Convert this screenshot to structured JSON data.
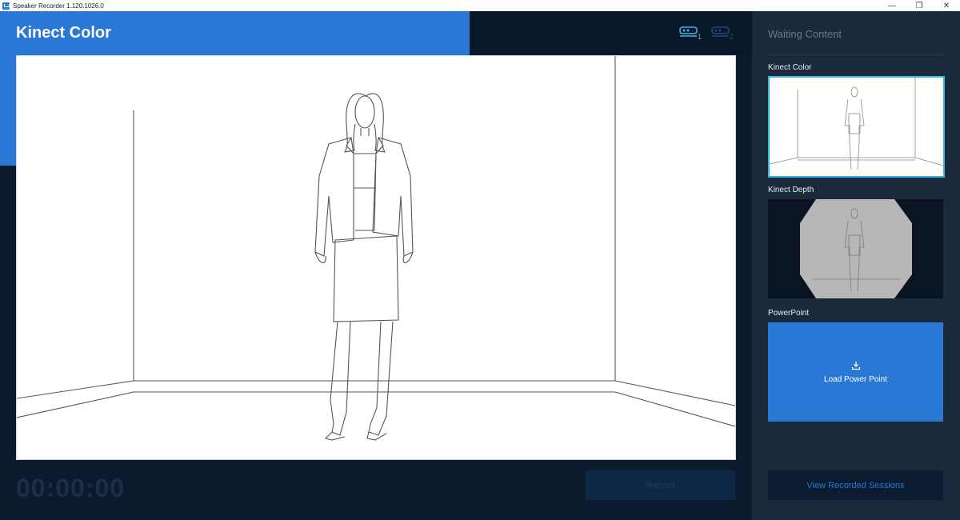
{
  "window": {
    "title": "Speaker Recorder 1.120.1026.0",
    "controls": {
      "minimize": "—",
      "maximize": "❐",
      "close": "✕"
    }
  },
  "header": {
    "title": "Kinect Color",
    "indicators": [
      {
        "label": "1",
        "active": true
      },
      {
        "label": "2",
        "active": false
      }
    ]
  },
  "recording": {
    "timer": "00:00:00",
    "record_label": "Record"
  },
  "sidebar": {
    "waiting_title": "Waiting Content",
    "sections": [
      {
        "label": "Kinect Color"
      },
      {
        "label": "Kinect Depth"
      },
      {
        "label": "PowerPoint"
      }
    ],
    "powerpoint_button": "Load Power Point",
    "view_sessions": "View Recorded Sessions"
  },
  "colors": {
    "accent_blue": "#2a78d6",
    "selected_border": "#37b6e6",
    "sidebar_bg": "#1a2a3b",
    "main_bg": "#0b1a2c"
  }
}
